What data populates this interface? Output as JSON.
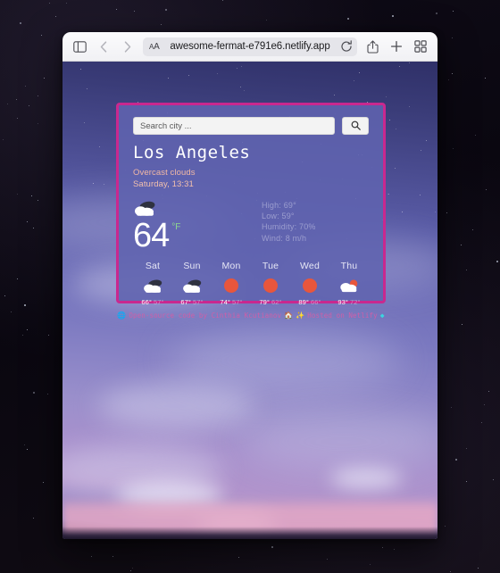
{
  "browser": {
    "url": "awesome-fermat-e791e6.netlify.app",
    "text_size_label": "AA",
    "icons": {
      "sidebar": "sidebar-icon",
      "back": "back-chevron-icon",
      "forward": "forward-chevron-icon",
      "reload": "reload-icon",
      "share": "share-icon",
      "new_tab": "plus-icon",
      "tab_overview": "tab-overview-icon"
    }
  },
  "app": {
    "search": {
      "placeholder": "Search city ...",
      "value": "",
      "button_icon": "search-icon"
    },
    "city": "Los Angeles",
    "condition": "Overcast clouds",
    "datetime": "Saturday, 13:31",
    "current": {
      "icon": "cloud-icon",
      "temperature": "64",
      "unit": "°F",
      "details": [
        "High: 69°",
        "Low: 59°",
        "Humidity: 70%",
        "Wind: 8 m/h"
      ]
    },
    "forecast": [
      {
        "day": "Sat",
        "icon": "cloud-icon",
        "high": "66°",
        "low": "57°"
      },
      {
        "day": "Sun",
        "icon": "cloud-icon",
        "high": "67°",
        "low": "57°"
      },
      {
        "day": "Mon",
        "icon": "sun-icon",
        "high": "74°",
        "low": "57°"
      },
      {
        "day": "Tue",
        "icon": "sun-icon",
        "high": "79°",
        "low": "62°"
      },
      {
        "day": "Wed",
        "icon": "sun-icon",
        "high": "89°",
        "low": "66°"
      },
      {
        "day": "Thu",
        "icon": "partly-cloudy-icon",
        "high": "93°",
        "low": "72°"
      }
    ],
    "footer": {
      "lead_glyph": "🌐",
      "credit_text": "Open-source code by Cinthia Kcutianov",
      "mid_glyph": "🏠",
      "sparkle_glyph": "✨",
      "hosted_text": "Hosted on Netlify",
      "end_glyph": "◆"
    },
    "colors": {
      "card_border": "#c9288f",
      "card_background": "#6063af",
      "accent_unit": "#8fd98f",
      "condition_text": "#f0b8a4",
      "sun_icon": "#e8563c",
      "footer_text": "#cf5fa8"
    }
  }
}
